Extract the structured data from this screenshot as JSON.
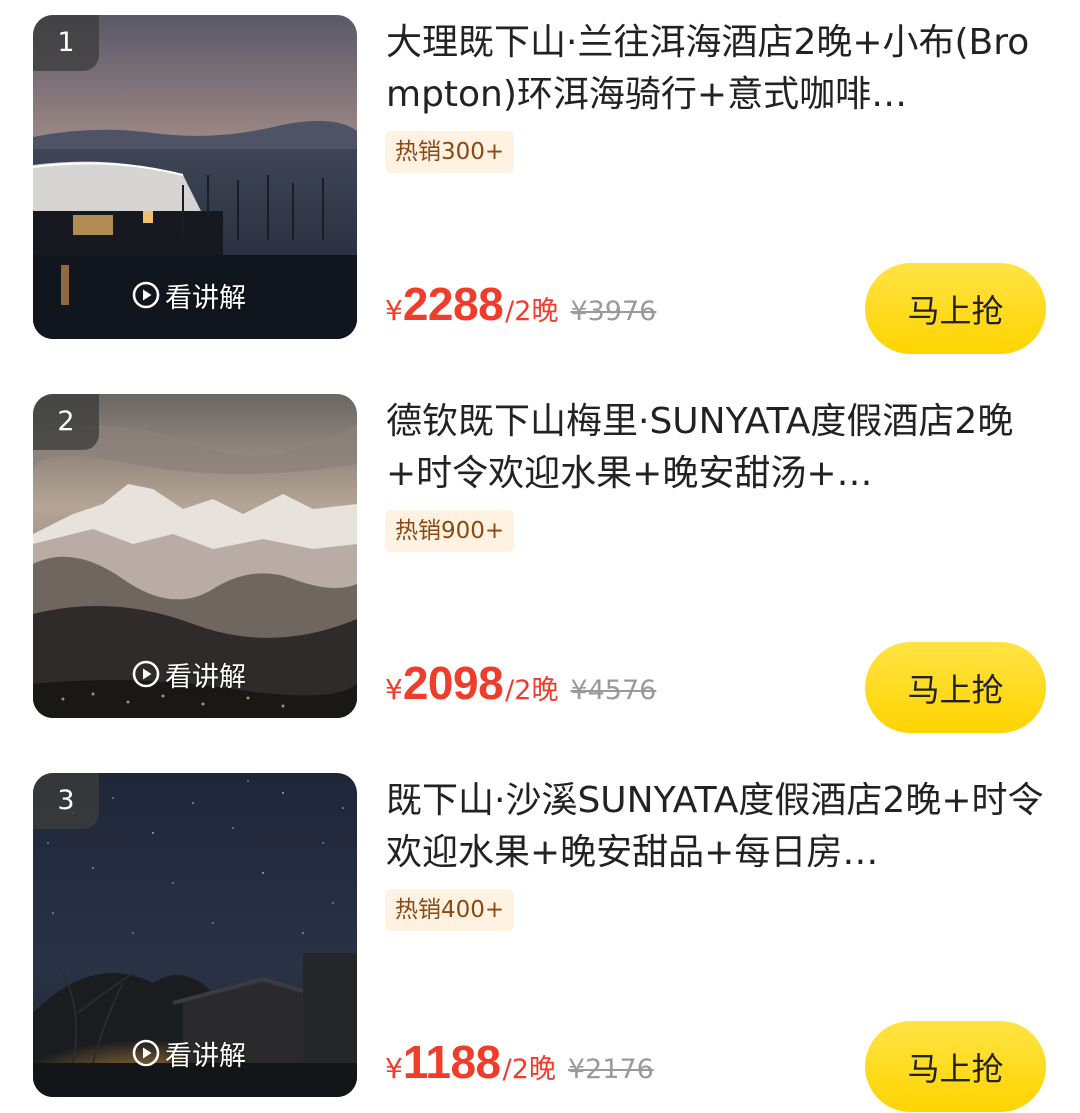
{
  "products": [
    {
      "rank": "1",
      "title": "大理既下山·兰往洱海酒店2晚+小布(Brompton)环洱海骑行+意式咖啡…",
      "badge": "热销300+",
      "currency": "¥",
      "price": "2288",
      "unit": "/2晚",
      "original_price": "¥3976",
      "button_label": "马上抢",
      "explain_label": "看讲解",
      "image_icon": "lakeside-hotel-photo"
    },
    {
      "rank": "2",
      "title": "德钦既下山梅里·SUNYATA度假酒店2晚+时令欢迎水果+晚安甜汤+…",
      "badge": "热销900+",
      "currency": "¥",
      "price": "2098",
      "unit": "/2晚",
      "original_price": "¥4576",
      "button_label": "马上抢",
      "explain_label": "看讲解",
      "image_icon": "snow-mountain-photo"
    },
    {
      "rank": "3",
      "title": "既下山·沙溪SUNYATA度假酒店2晚+时令欢迎水果+晚安甜品+每日房…",
      "badge": "热销400+",
      "currency": "¥",
      "price": "1188",
      "unit": "/2晚",
      "original_price": "¥2176",
      "button_label": "马上抢",
      "explain_label": "看讲解",
      "image_icon": "starry-village-photo"
    }
  ],
  "colors": {
    "price": "#f03c2a",
    "button": "#ffd400",
    "badge_bg": "#fff2e2",
    "badge_text": "#8a4a12"
  }
}
